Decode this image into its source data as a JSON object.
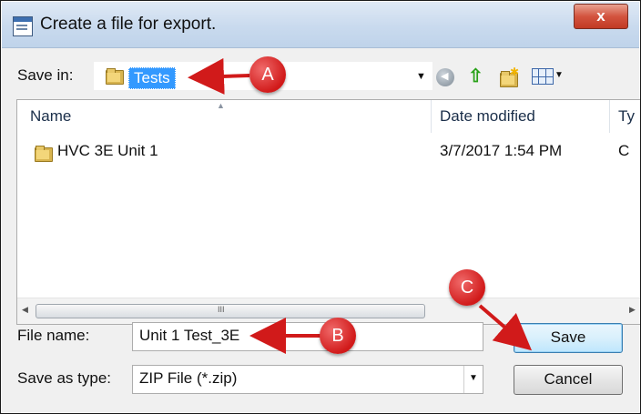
{
  "window": {
    "title": "Create a file for export.",
    "close_glyph": "x"
  },
  "save_in": {
    "label": "Save in:",
    "folder": "Tests"
  },
  "toolbar": {
    "icons": [
      "back-icon",
      "up-folder-icon",
      "new-folder-icon",
      "view-menu-icon"
    ]
  },
  "file_list": {
    "columns": [
      "Name",
      "Date modified",
      "Ty"
    ],
    "rows": [
      {
        "name": "HVC 3E Unit 1",
        "date_modified": "3/7/2017 1:54 PM",
        "type": "C"
      }
    ],
    "scroll_grip": "III"
  },
  "file_name": {
    "label": "File name:",
    "value": "Unit 1 Test_3E"
  },
  "save_as_type": {
    "label": "Save as type:",
    "value": "ZIP File (*.zip)"
  },
  "buttons": {
    "save": "Save",
    "cancel": "Cancel"
  },
  "callouts": {
    "a": "A",
    "b": "B",
    "c": "C"
  },
  "colors": {
    "callout": "#d11a1a",
    "selection": "#3399ff",
    "titlebar": "#c9daee"
  }
}
